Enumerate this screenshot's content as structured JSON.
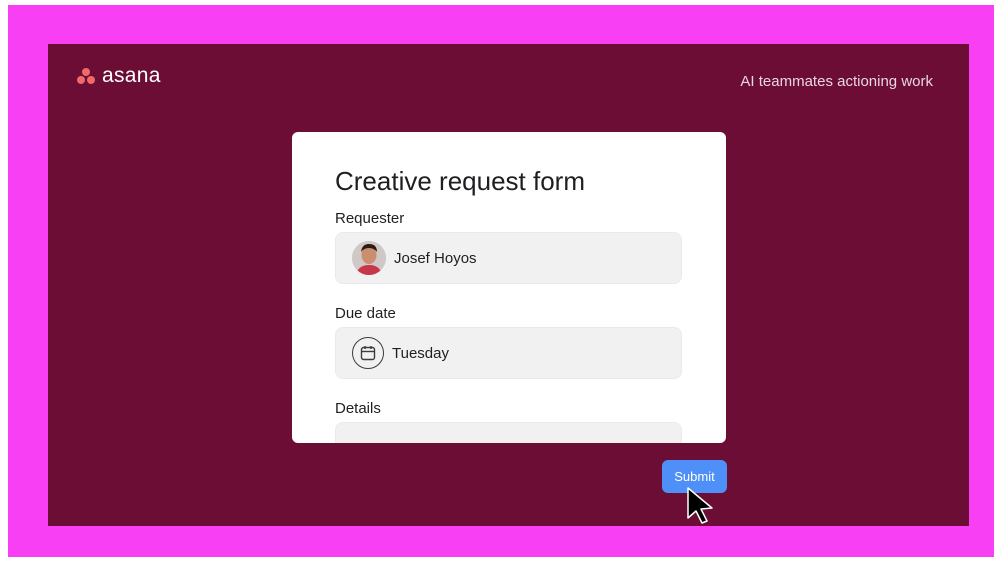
{
  "brand": {
    "logo_text": "asana",
    "tagline": "AI teammates actioning work",
    "logo_color": "#f06a6a"
  },
  "colors": {
    "frame": "#f93ff4",
    "slide_bg": "#6c0d36",
    "submit_bg": "#4f8ff8"
  },
  "form": {
    "title": "Creative request form",
    "requester": {
      "label": "Requester",
      "value": "Josef Hoyos"
    },
    "due_date": {
      "label": "Due date",
      "value": "Tuesday",
      "icon": "calendar-icon"
    },
    "details": {
      "label": "Details",
      "value": ""
    }
  },
  "submit_label": "Submit",
  "cursor": {
    "icon": "arrow-cursor-icon"
  }
}
